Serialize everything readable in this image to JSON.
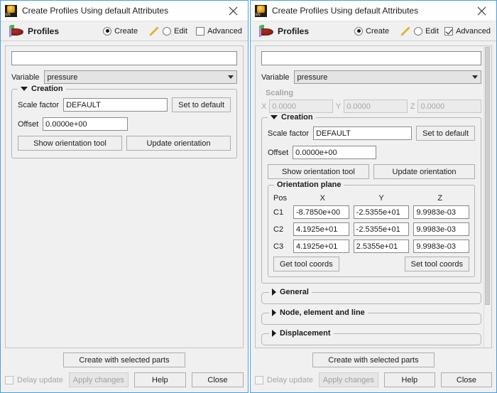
{
  "window_left": {
    "title": "Create Profiles Using default Attributes",
    "icon": "app-icon",
    "close_label": "close-icon",
    "header": {
      "icon": "profiles-icon",
      "label": "Profiles",
      "create_label": "Create",
      "create_selected": true,
      "pencil_icon": "pencil-icon",
      "edit_label": "Edit",
      "edit_selected": false,
      "advanced_label": "Advanced",
      "advanced_checked": false
    },
    "name_input": {
      "value": "",
      "placeholder": ""
    },
    "variable": {
      "label": "Variable",
      "value": "pressure"
    },
    "creation": {
      "legend": "Creation",
      "expanded": true,
      "scale_factor_label": "Scale factor",
      "scale_factor_value": "DEFAULT",
      "set_to_default_label": "Set to default",
      "offset_label": "Offset",
      "offset_value": "0.0000e+00",
      "show_orientation_label": "Show orientation tool",
      "update_orientation_label": "Update orientation"
    },
    "footer": {
      "create_with_selected_parts": "Create with selected parts",
      "delay_update_label": "Delay update",
      "delay_update_checked": false,
      "apply_changes_label": "Apply changes",
      "apply_enabled": false,
      "help_label": "Help",
      "close_label": "Close"
    }
  },
  "window_right": {
    "title": "Create Profiles Using default Attributes",
    "icon": "app-icon",
    "close_label": "close-icon",
    "header": {
      "icon": "profiles-icon",
      "label": "Profiles",
      "create_label": "Create",
      "create_selected": true,
      "pencil_icon": "pencil-icon",
      "edit_label": "Edit",
      "edit_selected": false,
      "advanced_label": "Advanced",
      "advanced_checked": true
    },
    "name_input": {
      "value": "",
      "placeholder": ""
    },
    "variable": {
      "label": "Variable",
      "value": "pressure"
    },
    "scaling": {
      "title": "Scaling",
      "enabled": false,
      "x_label": "X",
      "x_value": "0.0000",
      "y_label": "Y",
      "y_value": "0.0000",
      "z_label": "Z",
      "z_value": "0.0000"
    },
    "creation": {
      "legend": "Creation",
      "expanded": true,
      "scale_factor_label": "Scale factor",
      "scale_factor_value": "DEFAULT",
      "set_to_default_label": "Set to default",
      "offset_label": "Offset",
      "offset_value": "0.0000e+00",
      "show_orientation_label": "Show orientation tool",
      "update_orientation_label": "Update orientation",
      "orientation_plane": {
        "legend": "Orientation plane",
        "headers": [
          "Pos",
          "X",
          "Y",
          "Z"
        ],
        "rows": [
          {
            "pos": "C1",
            "x": "-8.7850e+00",
            "y": "-2.5355e+01",
            "z": "9.9983e-03"
          },
          {
            "pos": "C2",
            "x": "4.1925e+01",
            "y": "-2.5355e+01",
            "z": "9.9983e-03"
          },
          {
            "pos": "C3",
            "x": "4.1925e+01",
            "y": "2.5355e+01",
            "z": "9.9983e-03"
          }
        ],
        "get_tool_coords_label": "Get tool coords",
        "set_tool_coords_label": "Set tool coords"
      }
    },
    "collapsed_sections": [
      {
        "legend": "General",
        "expanded": false
      },
      {
        "legend": "Node, element and line",
        "expanded": false
      },
      {
        "legend": "Displacement",
        "expanded": false
      }
    ],
    "footer": {
      "create_with_selected_parts": "Create with selected parts",
      "delay_update_label": "Delay update",
      "delay_update_checked": false,
      "apply_changes_label": "Apply changes",
      "apply_enabled": false,
      "help_label": "Help",
      "close_label": "Close"
    }
  },
  "colors": {
    "window_border": "#4a9fe0",
    "dialog_bg": "#f0f0f0",
    "titlebar_bg": "#ffffff",
    "field_bg": "#ffffff",
    "combo_bg": "#e4e4e4",
    "button_bg": "#efefef",
    "disabled_text": "#a6a6a6",
    "pencil_yellow": "#f2c423",
    "profile_flag_red": "#8d1a16"
  }
}
